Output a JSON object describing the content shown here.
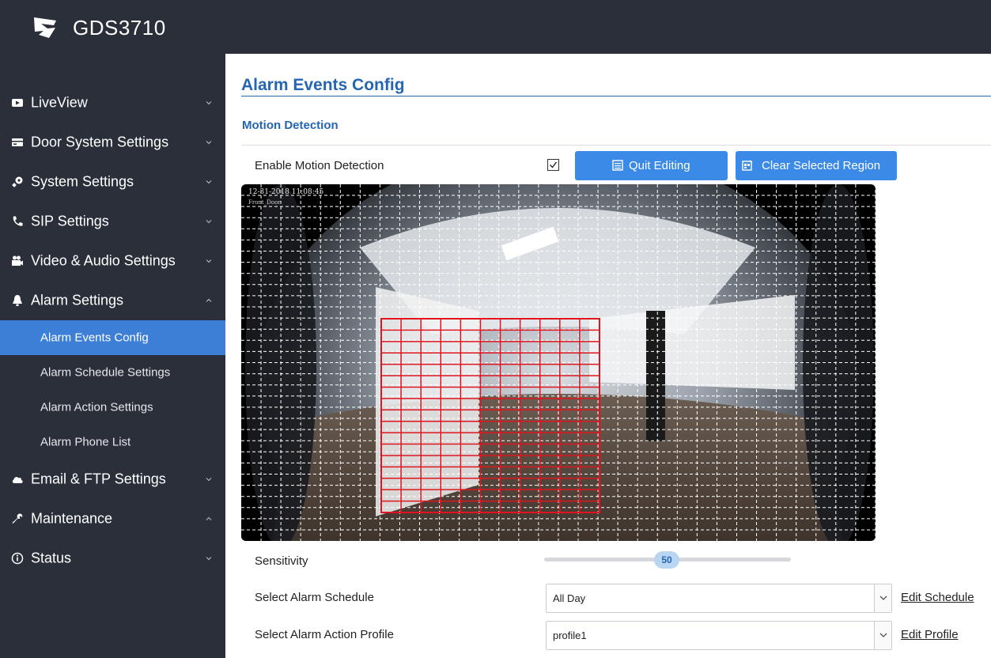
{
  "header": {
    "app_title": "GDS3710"
  },
  "sidebar": {
    "items": [
      {
        "label": "LiveView",
        "icon": "video-icon",
        "chevron": "down"
      },
      {
        "label": "Door System Settings",
        "icon": "door-icon",
        "chevron": "down"
      },
      {
        "label": "System Settings",
        "icon": "settings-icon",
        "chevron": "down"
      },
      {
        "label": "SIP Settings",
        "icon": "phone-icon",
        "chevron": "down"
      },
      {
        "label": "Video & Audio Settings",
        "icon": "camera-icon",
        "chevron": "down"
      },
      {
        "label": "Alarm Settings",
        "icon": "bell-icon",
        "chevron": "up"
      },
      {
        "label": "Email & FTP Settings",
        "icon": "cloud-icon",
        "chevron": "down"
      },
      {
        "label": "Maintenance",
        "icon": "wrench-icon",
        "chevron": "up"
      },
      {
        "label": "Status",
        "icon": "info-icon",
        "chevron": "down"
      }
    ],
    "alarm_subitems": [
      {
        "label": "Alarm Events Config",
        "active": true
      },
      {
        "label": "Alarm Schedule Settings",
        "active": false
      },
      {
        "label": "Alarm Action Settings",
        "active": false
      },
      {
        "label": "Alarm Phone List",
        "active": false
      }
    ]
  },
  "main": {
    "page_title": "Alarm Events Config",
    "section_title": "Motion Detection",
    "enable_label": "Enable Motion Detection",
    "enable_checked": true,
    "quit_editing_label": "Quit Editing",
    "clear_region_label": "Clear Selected Region",
    "video": {
      "osd_timestamp": "12-31-2018 11:08:45",
      "osd_camera_name": "Front_Door",
      "selected_grid_color": "#e0141e",
      "grid_color": "#ffffff"
    },
    "sensitivity_label": "Sensitivity",
    "sensitivity_value": "50",
    "schedule_label": "Select Alarm Schedule",
    "schedule_value": "All Day",
    "edit_schedule_label": "Edit Schedule",
    "action_profile_label": "Select Alarm Action Profile",
    "action_profile_value": "profile1",
    "edit_profile_label": "Edit Profile"
  },
  "colors": {
    "sidebar_bg": "#2b2f3a",
    "active_item": "#3d7fd6",
    "accent": "#2566b3",
    "button": "#3b8ae8"
  }
}
